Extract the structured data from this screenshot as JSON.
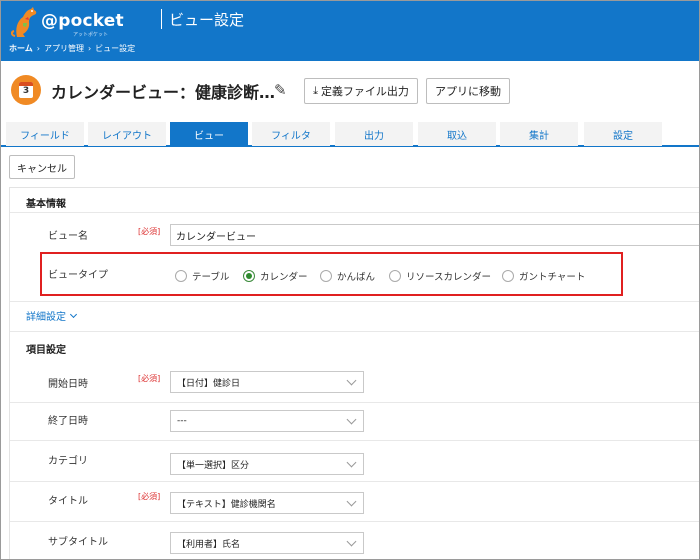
{
  "header": {
    "logo_text": "@pocket",
    "logo_subtext": "アットポケット",
    "title": "ビュー設定",
    "breadcrumbs": [
      "ホーム",
      "アプリ管理",
      "ビュー設定"
    ],
    "breadcrumb_separator": "›"
  },
  "app": {
    "icon_number": "3",
    "title": "カレンダービュー：健康診断…",
    "export_button": "定義ファイル出力",
    "goto_app_button": "アプリに移動"
  },
  "tabs": [
    {
      "label": "フィールド",
      "active": false
    },
    {
      "label": "レイアウト",
      "active": false
    },
    {
      "label": "ビュー",
      "active": true
    },
    {
      "label": "フィルタ",
      "active": false
    },
    {
      "label": "出力",
      "active": false
    },
    {
      "label": "取込",
      "active": false
    },
    {
      "label": "集計",
      "active": false
    },
    {
      "label": "設定",
      "active": false
    }
  ],
  "cancel_button": "キャンセル",
  "basic_info": {
    "section_title": "基本情報",
    "view_name_label": "ビュー名",
    "required_label": "[必須]",
    "view_name_value": "カレンダービュー",
    "view_type_label": "ビュータイプ",
    "view_types": [
      {
        "label": "テーブル",
        "checked": false
      },
      {
        "label": "カレンダー",
        "checked": true
      },
      {
        "label": "かんばん",
        "checked": false
      },
      {
        "label": "リソースカレンダー",
        "checked": false
      },
      {
        "label": "ガントチャート",
        "checked": false
      }
    ]
  },
  "detail_settings_link": "詳細設定",
  "item_settings": {
    "section_title": "項目設定",
    "fields": [
      {
        "label": "開始日時",
        "required": "[必須]",
        "value": "【日付】健診日"
      },
      {
        "label": "終了日時",
        "required": "",
        "value": "---"
      },
      {
        "label": "カテゴリ",
        "required": "",
        "value": "【単一選択】区分"
      },
      {
        "label": "タイトル",
        "required": "[必須]",
        "value": "【テキスト】健診機関名"
      },
      {
        "label": "サブタイトル",
        "required": "",
        "value": "【利用者】氏名"
      }
    ]
  },
  "colors": {
    "header_blue": "#1276c9",
    "accent_orange": "#f08a24",
    "highlight_red": "#e02020",
    "radio_green": "#2e8b2e"
  }
}
